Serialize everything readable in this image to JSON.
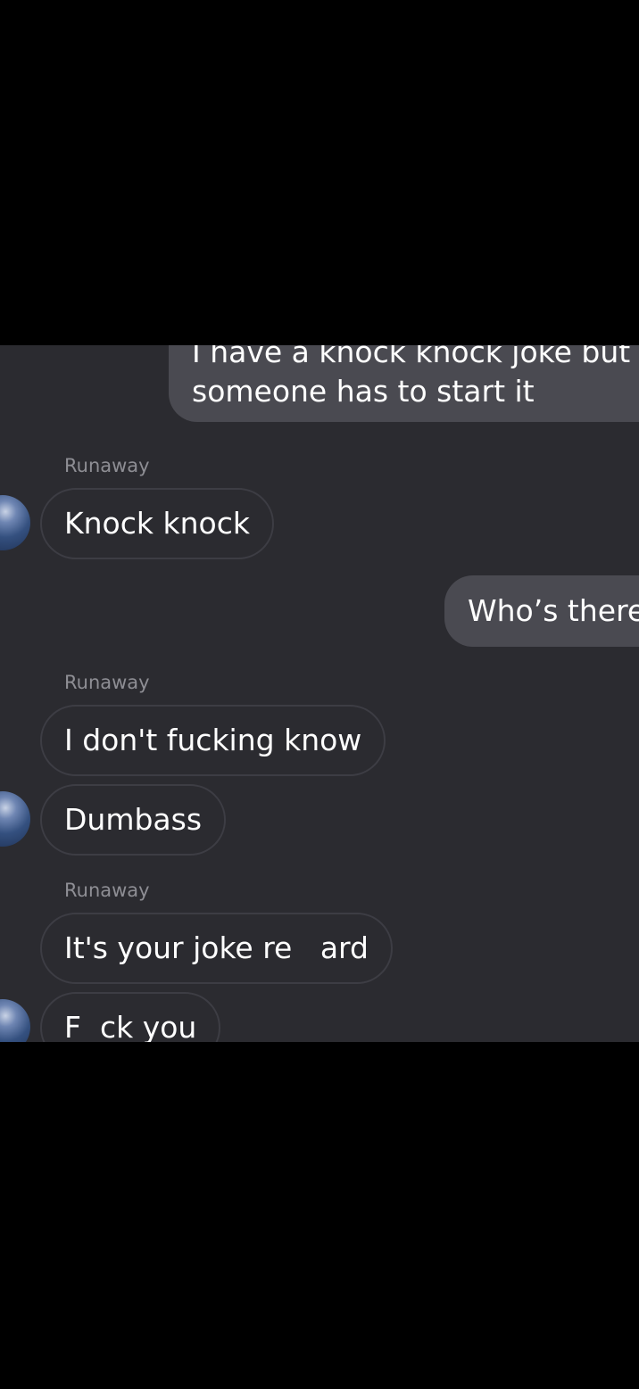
{
  "thread": {
    "messages": [
      {
        "direction": "outgoing",
        "lines": [
          "I have a knock knock joke but",
          "someone has to start it"
        ]
      },
      {
        "direction": "incoming",
        "sender": "Runaway",
        "text": "Knock knock"
      },
      {
        "direction": "outgoing",
        "text": "Who’s there"
      },
      {
        "direction": "incoming",
        "sender": "Runaway",
        "text": "I don't fucking know"
      },
      {
        "direction": "incoming",
        "text": "Dumbass"
      },
      {
        "direction": "incoming",
        "sender": "Runaway",
        "text": "It's your joke re   ard"
      },
      {
        "direction": "incoming",
        "text": "F  ck you"
      }
    ]
  },
  "colors": {
    "background": "#2b2b30",
    "outgoing_bubble": "#4a4a51",
    "incoming_border": "#3d3d44",
    "sender_text": "#8e8e94",
    "letterbox": "#000000"
  },
  "icons": {
    "avatar": "avatar-planet-icon"
  }
}
